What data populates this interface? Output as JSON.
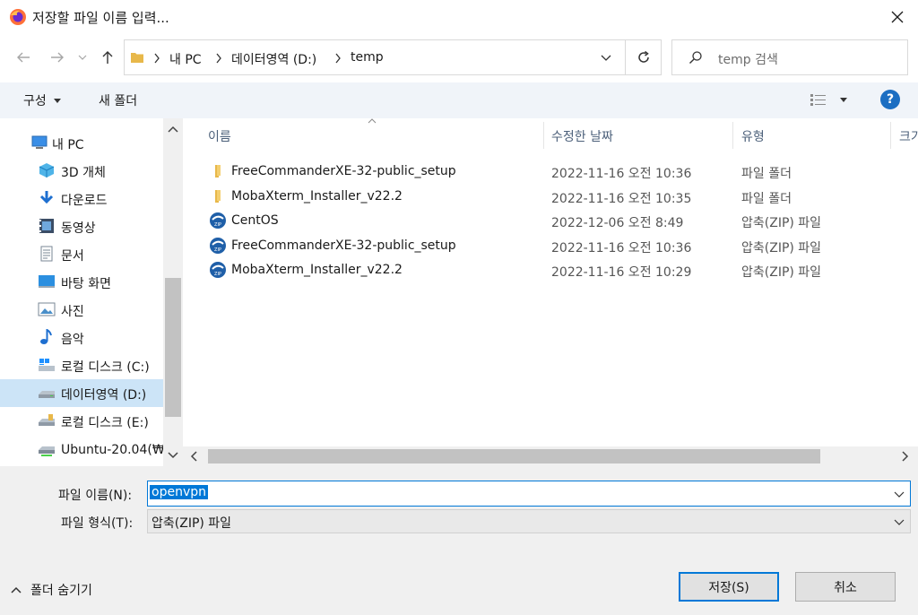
{
  "window": {
    "title": "저장할 파일 이름 입력..."
  },
  "address": {
    "segments": [
      "내 PC",
      "데이터영역 (D:)",
      "temp"
    ]
  },
  "search": {
    "placeholder": "temp 검색"
  },
  "toolbar": {
    "organize_label": "구성",
    "new_folder_label": "새 폴더",
    "help_label": "?"
  },
  "nav": {
    "items": [
      {
        "label": "내 PC",
        "icon": "computer-icon"
      },
      {
        "label": "3D 개체",
        "icon": "cube-icon"
      },
      {
        "label": "다운로드",
        "icon": "download-arrow-icon"
      },
      {
        "label": "동영상",
        "icon": "video-icon"
      },
      {
        "label": "문서",
        "icon": "document-icon"
      },
      {
        "label": "바탕 화면",
        "icon": "desktop-icon"
      },
      {
        "label": "사진",
        "icon": "picture-icon"
      },
      {
        "label": "음악",
        "icon": "music-note-icon"
      },
      {
        "label": "로컬 디스크 (C:)",
        "icon": "windows-drive-icon"
      },
      {
        "label": "데이터영역 (D:)",
        "icon": "drive-icon"
      },
      {
        "label": "로컬 디스크 (E:)",
        "icon": "drive-icon"
      },
      {
        "label": "Ubuntu-20.04(₩",
        "icon": "network-drive-icon"
      }
    ]
  },
  "columns": {
    "name": "이름",
    "modified": "수정한 날짜",
    "type": "유형",
    "size": "크기"
  },
  "files": [
    {
      "name": "FreeCommanderXE-32-public_setup",
      "date": "2022-11-16 오전 10:36",
      "type": "파일 폴더",
      "kind": "folder"
    },
    {
      "name": "MobaXterm_Installer_v22.2",
      "date": "2022-11-16 오전 10:35",
      "type": "파일 폴더",
      "kind": "folder"
    },
    {
      "name": "CentOS",
      "date": "2022-12-06 오전 8:49",
      "type": "압축(ZIP) 파일",
      "kind": "zip"
    },
    {
      "name": "FreeCommanderXE-32-public_setup",
      "date": "2022-11-16 오전 10:36",
      "type": "압축(ZIP) 파일",
      "kind": "zip"
    },
    {
      "name": "MobaXterm_Installer_v22.2",
      "date": "2022-11-16 오전 10:29",
      "type": "압축(ZIP) 파일",
      "kind": "zip"
    }
  ],
  "form": {
    "filename_label": "파일 이름(N):",
    "filename_value": "openvpn",
    "filetype_label": "파일 형식(T):",
    "filetype_value": "압축(ZIP) 파일"
  },
  "footer": {
    "hide_folders_label": "폴더 숨기기",
    "save_label": "저장(S)",
    "cancel_label": "취소"
  },
  "colors": {
    "accent": "#0078d7",
    "selected_nav": "#cce4f7",
    "folder": "#e8b84a",
    "zip_icon": "#1f5fa8"
  }
}
